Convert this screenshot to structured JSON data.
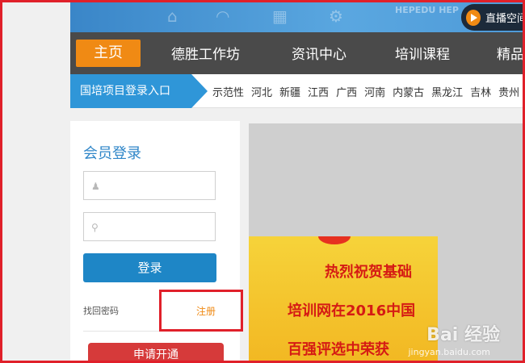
{
  "header": {
    "banner_watermark": "HEPEDU HEP",
    "live_button_label": "直播空间"
  },
  "nav": {
    "items": [
      {
        "label": "主页",
        "active": true
      },
      {
        "label": "德胜工作坊",
        "active": false
      },
      {
        "label": "资讯中心",
        "active": false
      },
      {
        "label": "培训课程",
        "active": false
      },
      {
        "label": "精品",
        "active": false
      }
    ]
  },
  "regions": {
    "entry_label": "国培项目登录入口",
    "list": [
      "示范性",
      "河北",
      "新疆",
      "江西",
      "广西",
      "河南",
      "内蒙古",
      "黑龙江",
      "吉林",
      "贵州",
      "四"
    ]
  },
  "login": {
    "title": "会员登录",
    "username_placeholder": "",
    "password_placeholder": "",
    "login_button": "登录",
    "forgot_password": "找回密码",
    "register": "注册",
    "apply_button": "申请开通"
  },
  "promo": {
    "lines": [
      "热烈祝贺基础",
      "培训网在2016中国",
      "百强评选中荣获"
    ]
  },
  "watermark": {
    "brand": "Bai 经验",
    "url": "jingyan.baidu.com"
  },
  "colors": {
    "highlight_border": "#e0202a",
    "nav_active": "#f08a14",
    "region_entry": "#2f96d8",
    "login_button": "#1e86c6",
    "apply_button": "#d63a3a"
  },
  "icons": {
    "username": "user-icon",
    "password": "key-icon",
    "live": "play-icon"
  }
}
